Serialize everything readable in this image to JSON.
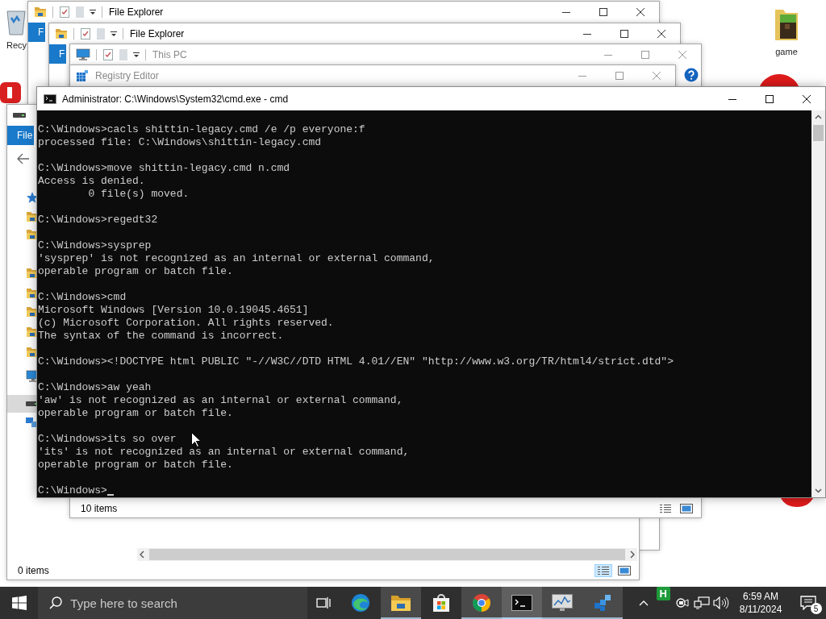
{
  "desktop_icons": [
    {
      "kind": "recycle_bin",
      "label": "Recy"
    },
    {
      "kind": "folder",
      "label": "game"
    }
  ],
  "windows": [
    {
      "kind": "explorer",
      "title": "File Explorer",
      "greyed": false,
      "ribbon_tab": "F"
    },
    {
      "kind": "explorer",
      "title": "File Explorer",
      "greyed": false,
      "ribbon_tab": "F"
    },
    {
      "kind": "this_pc",
      "title": "This PC",
      "greyed": true,
      "help": true,
      "status": "10 items",
      "views": [
        {
          "selected": false
        },
        {
          "selected": false
        }
      ]
    },
    {
      "kind": "regedit",
      "title": "Registry Editor",
      "greyed": true
    },
    {
      "kind": "explorer_nav",
      "ribbon_tab": "File",
      "status": "0 items",
      "views": [
        {
          "selected": true
        },
        {
          "selected": false
        }
      ]
    }
  ],
  "console": {
    "title": "Administrator: C:\\Windows\\System32\\cmd.exe - cmd",
    "blocks": [
      {
        "lines": [
          "C:\\Windows>cacls shittin-legacy.cmd /e /p everyone:f",
          "processed file: C:\\Windows\\shittin-legacy.cmd"
        ]
      },
      {
        "lines": [
          "C:\\Windows>move shittin-legacy.cmd n.cmd",
          "Access is denied.",
          "        0 file(s) moved."
        ]
      },
      {
        "lines": [
          "C:\\Windows>regedt32"
        ]
      },
      {
        "lines": [
          "C:\\Windows>sysprep",
          "'sysprep' is not recognized as an internal or external command,",
          "operable program or batch file."
        ]
      },
      {
        "lines": [
          "C:\\Windows>cmd",
          "Microsoft Windows [Version 10.0.19045.4651]",
          "(c) Microsoft Corporation. All rights reserved.",
          "The syntax of the command is incorrect."
        ]
      },
      {
        "lines": [
          "C:\\Windows><!DOCTYPE html PUBLIC \"-//W3C//DTD HTML 4.01//EN\" \"http://www.w3.org/TR/html4/strict.dtd\">"
        ]
      },
      {
        "lines": [
          "C:\\Windows>aw yeah",
          "'aw' is not recognized as an internal or external command,",
          "operable program or batch file."
        ]
      },
      {
        "lines": [
          "C:\\Windows>its so over",
          "'its' is not recognized as an internal or external command,",
          "operable program or batch file."
        ]
      }
    ],
    "prompt": "C:\\Windows>"
  },
  "taskbar": {
    "search_placeholder": "Type here to search",
    "apps": [
      {
        "kind": "edge",
        "running": false,
        "selected": false
      },
      {
        "kind": "explorer",
        "running": true,
        "selected": false
      },
      {
        "kind": "store",
        "running": false,
        "selected": false
      },
      {
        "kind": "chrome",
        "running": true,
        "selected": false
      },
      {
        "kind": "console",
        "running": true,
        "selected": true
      },
      {
        "kind": "monitor",
        "running": true,
        "selected": false
      },
      {
        "kind": "regedit",
        "running": true,
        "selected": false
      }
    ],
    "tray_app_label": "H",
    "time": "6:59 AM",
    "date": "8/11/2024",
    "notification_count": "5"
  }
}
